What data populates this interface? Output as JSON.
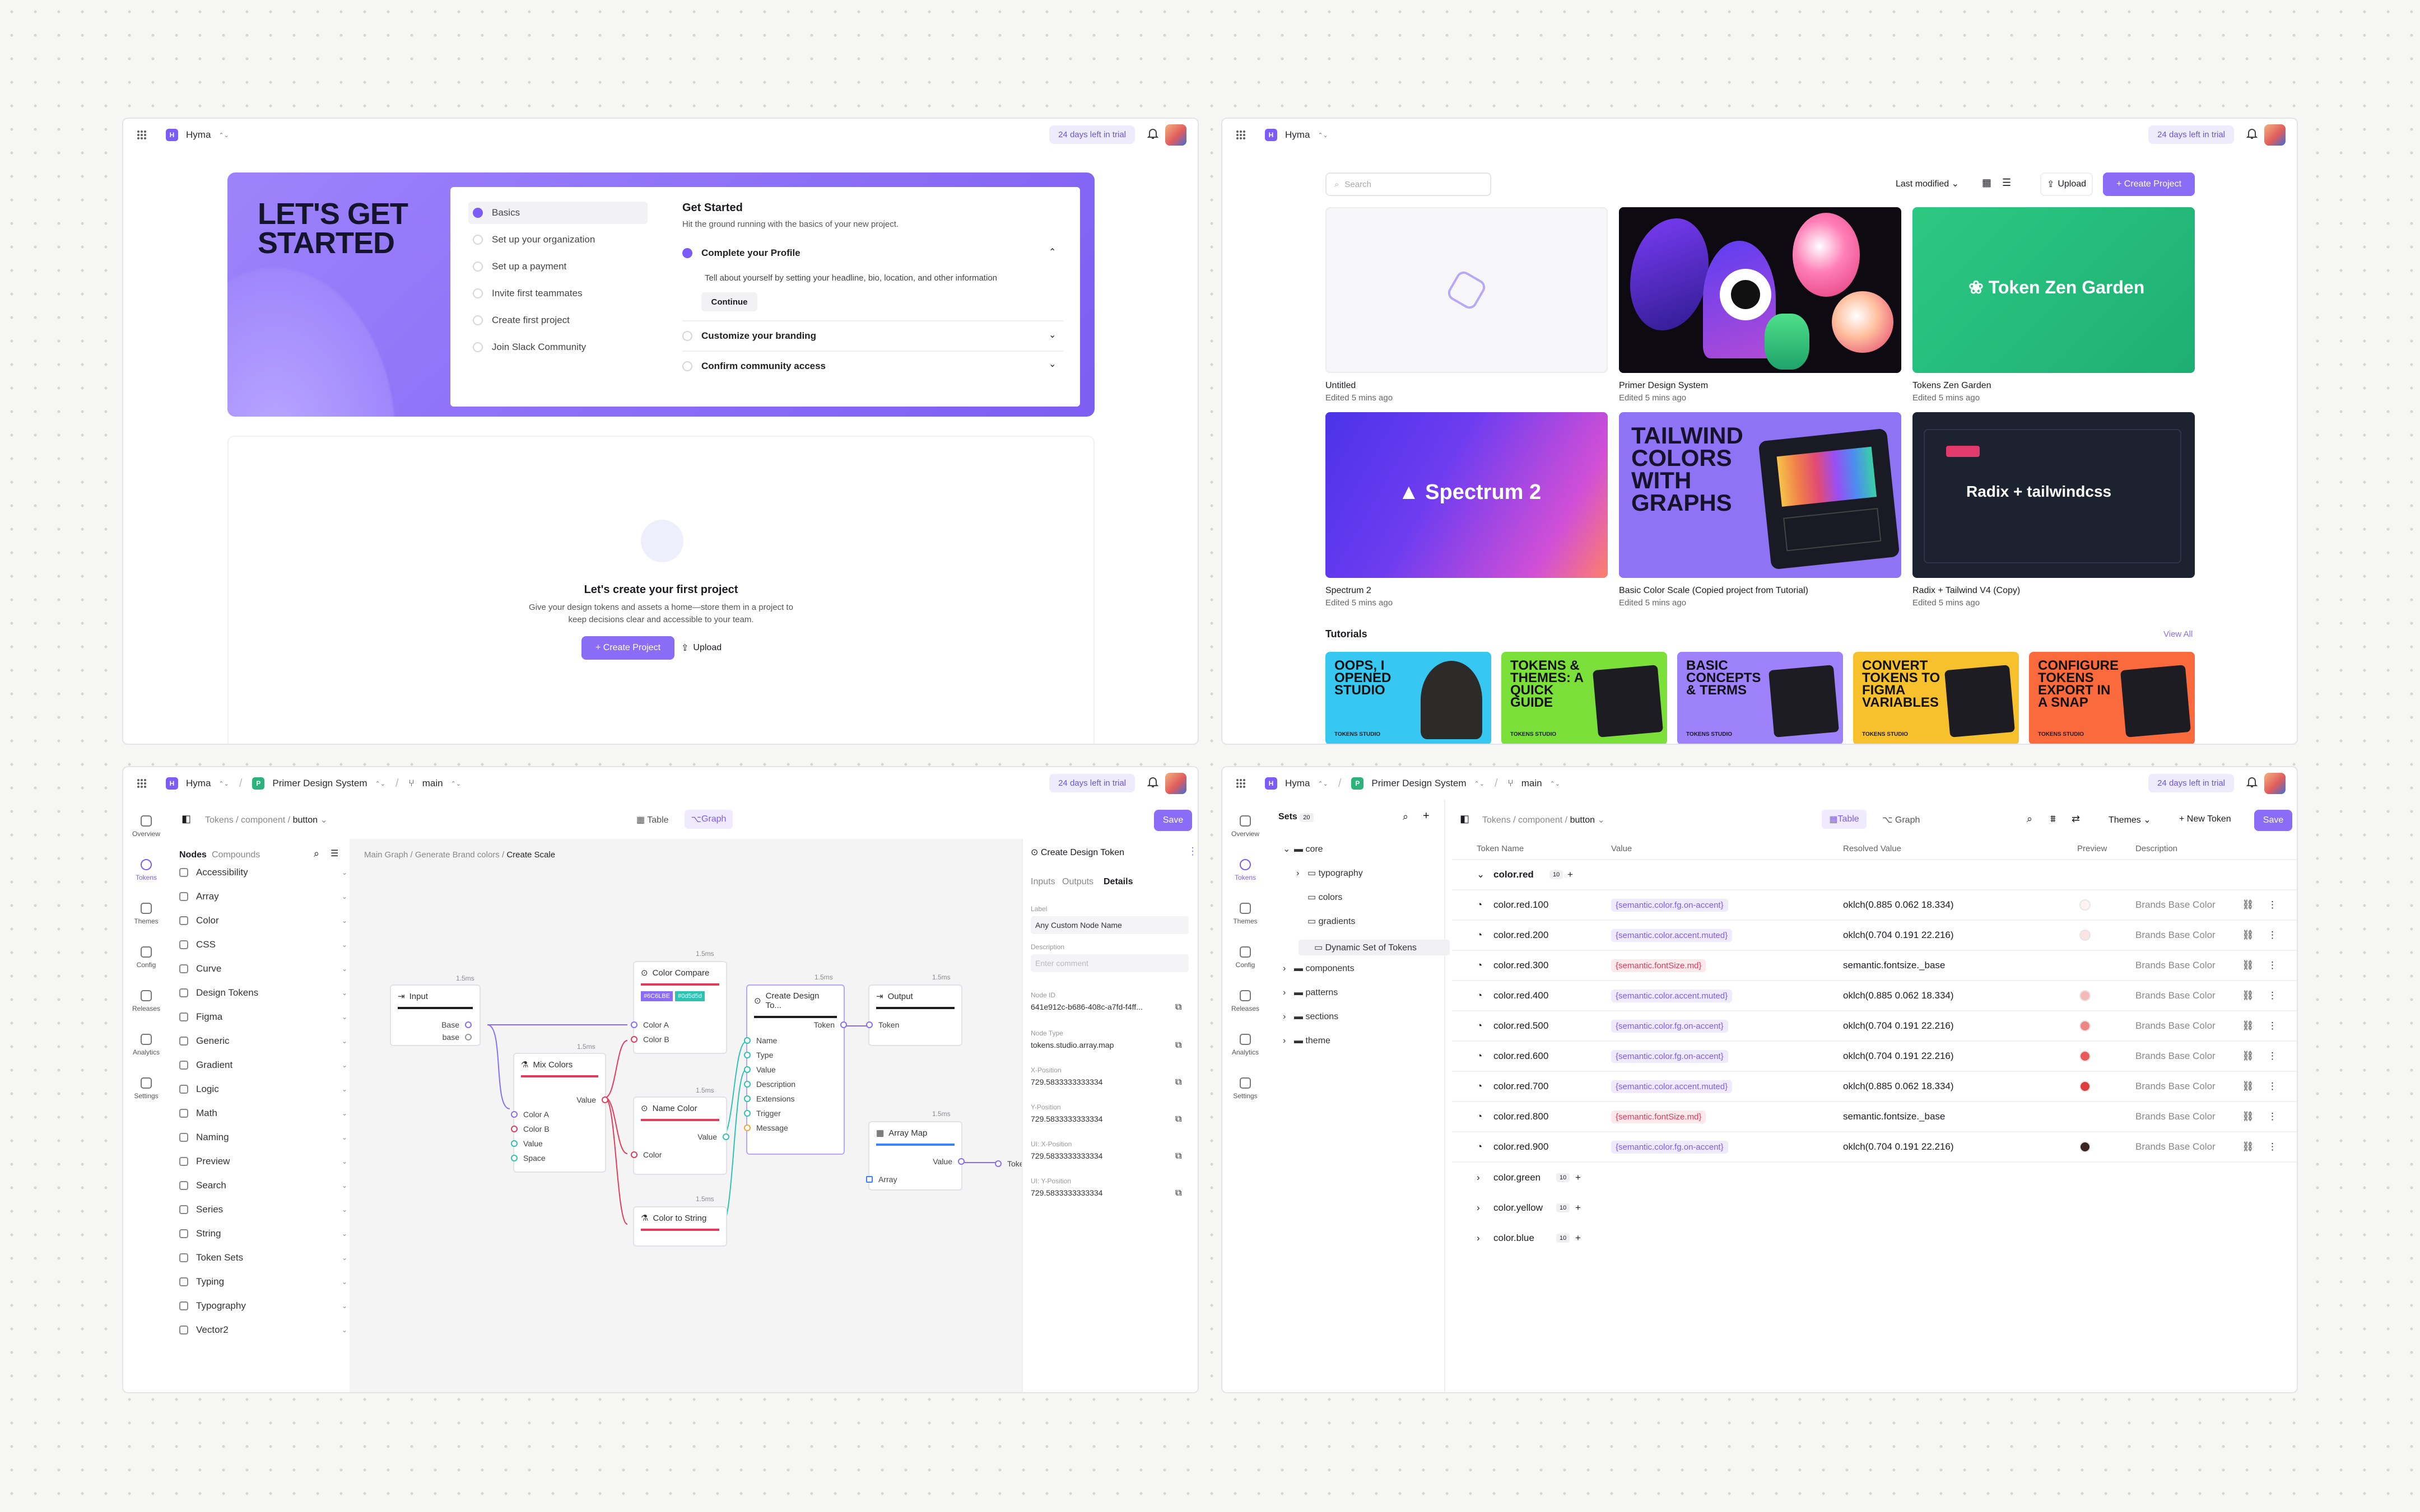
{
  "workspace": "Hyma",
  "trial": "24 days left in trial",
  "onboard": {
    "title_l1": "LET'S GET",
    "title_l2": "STARTED",
    "steps": [
      "Basics",
      "Set up your organization",
      "Set up a payment",
      "Invite first teammates",
      "Create first project",
      "Join Slack Community"
    ],
    "heading": "Get Started",
    "sub": "Hit the ground running with the basics of your new project.",
    "acc1": "Complete your Profile",
    "acc1_desc": "Tell about yourself by setting your headline, bio, location, and other information",
    "continue": "Continue",
    "acc2": "Customize your branding",
    "acc3": "Confirm community access",
    "empty_title": "Let's create your first project",
    "empty_desc1": "Give your design tokens and assets a home—store them in a project to",
    "empty_desc2": "keep decisions clear and accessible to your team.",
    "create_btn": "+ Create Project",
    "upload_btn": "Upload"
  },
  "projects": {
    "search_ph": "Search",
    "sort": "Last modified",
    "upload": "Upload",
    "create": "+ Create Project",
    "items": [
      {
        "name": "Untitled",
        "time": "Edited 5 mins ago"
      },
      {
        "name": "Primer Design System",
        "time": "Edited 5 mins ago"
      },
      {
        "name": "Tokens Zen Garden",
        "time": "Edited 5 mins ago",
        "label": "Token Zen Garden"
      },
      {
        "name": "Spectrum 2",
        "time": "Edited 5 mins ago",
        "label": "Spectrum 2"
      },
      {
        "name": "Basic Color Scale (Copied project from Tutorial)",
        "time": "Edited 5 mins ago",
        "label": "TAILWIND COLORS WITH GRAPHS"
      },
      {
        "name": "Radix + Tailwind V4 (Copy)",
        "time": "Edited 5 mins ago",
        "label": "Radix + tailwindcss"
      }
    ],
    "tutorials": "Tutorials",
    "view_all": "View All",
    "tut": [
      "OOPS, I OPENED STUDIO",
      "TOKENS & THEMES: A QUICK GUIDE",
      "BASIC CONCEPTS & TERMS",
      "CONVERT TOKENS TO FIGMA VARIABLES",
      "CONFIGURE TOKENS EXPORT IN A SNAP"
    ],
    "tut_brand": "TOKENS STUDIO"
  },
  "graph": {
    "project": "Primer Design System",
    "branch": "main",
    "nav": [
      "Overview",
      "Tokens",
      "Themes",
      "Config",
      "Releases",
      "Analytics",
      "Settings"
    ],
    "crumb1": "Tokens",
    "crumb2": "component",
    "crumb3": "button",
    "view_table": "Table",
    "view_graph": "Graph",
    "save": "Save",
    "tab_nodes": "Nodes",
    "tab_compounds": "Compounds",
    "nodes": [
      "Accessibility",
      "Array",
      "Color",
      "CSS",
      "Curve",
      "Design Tokens",
      "Figma",
      "Generic",
      "Gradient",
      "Logic",
      "Math",
      "Naming",
      "Preview",
      "Search",
      "Series",
      "String",
      "Token Sets",
      "Typing",
      "Typography",
      "Vector2"
    ],
    "path1": "Main Graph",
    "path2": "Generate Brand colors",
    "path3": "Create Scale",
    "n_input": "Input",
    "n_compare": "Color Compare",
    "n_mix": "Mix Colors",
    "n_name": "Name Color",
    "n_tostr": "Color to String",
    "n_create": "Create Design To...",
    "n_output": "Output",
    "n_arraymap": "Array Map",
    "p_base": "Base",
    "p_base2": "base",
    "p_colora": "Color A",
    "p_colorb": "Color B",
    "p_value": "Value",
    "p_space": "Space",
    "p_color": "Color",
    "p_name": "Name",
    "p_type": "Type",
    "p_desc": "Description",
    "p_ext": "Extensions",
    "p_trig": "Trigger",
    "p_msg": "Message",
    "p_token": "Token",
    "p_array": "Array",
    "p_toke": "Toke",
    "hex1": "#6C6LBE",
    "hex2": "#0d5d5d",
    "t15": "1.5ms",
    "panel_title": "Create Design Token",
    "ptabs": [
      "Inputs",
      "Outputs",
      "Details"
    ],
    "f_label": "Label",
    "v_label": "Any Custom Node Name",
    "f_desc": "Description",
    "v_desc": "Enter comment",
    "f_id": "Node ID",
    "v_id": "641e912c-b686-408c-a7fd-f4ff...",
    "f_type": "Node Type",
    "v_type": "tokens.studio.array.map",
    "f_x": "X-Position",
    "v_x": "729.5833333333334",
    "f_y": "Y-Position",
    "v_y": "729.5833333333334",
    "f_ux": "UI: X-Position",
    "v_ux": "729.5833333333334",
    "f_uy": "UI: Y-Position",
    "v_uy": "729.5833333333334"
  },
  "table": {
    "sets_label": "Sets",
    "sets_count": "20",
    "tree": [
      "core",
      "typography",
      "colors",
      "gradients",
      "Dynamic Set of Tokens",
      "components",
      "patterns",
      "sections",
      "theme"
    ],
    "themes": "Themes",
    "new_token": "+ New Token",
    "cols": [
      "Token Name",
      "Value",
      "Resolved Value",
      "Preview",
      "Description"
    ],
    "group": "color.red",
    "group_count": "10",
    "rows": [
      {
        "name": "color.red.100",
        "value": "{semantic.color.fg.on-accent}",
        "res": "oklch(0.885 0.062 18.334)",
        "sw": "#fdf3f3",
        "desc": "Brands Base Color"
      },
      {
        "name": "color.red.200",
        "value": "{semantic.color.accent.muted}",
        "res": "oklch(0.704 0.191 22.216)",
        "sw": "#fbe3e3",
        "desc": "Brands Base Color"
      },
      {
        "name": "color.red.300",
        "value": "{semantic.fontSize.md}",
        "res": "semantic.fontsize._base",
        "sw": "",
        "desc": "Brands Base Color"
      },
      {
        "name": "color.red.400",
        "value": "{semantic.color.accent.muted}",
        "res": "oklch(0.885 0.062 18.334)",
        "sw": "#f6b9b9",
        "desc": "Brands Base Color"
      },
      {
        "name": "color.red.500",
        "value": "{semantic.color.fg.on-accent}",
        "res": "oklch(0.704 0.191 22.216)",
        "sw": "#ef8585",
        "desc": "Brands Base Color"
      },
      {
        "name": "color.red.600",
        "value": "{semantic.color.fg.on-accent}",
        "res": "oklch(0.704 0.191 22.216)",
        "sw": "#e85a5a",
        "desc": "Brands Base Color"
      },
      {
        "name": "color.red.700",
        "value": "{semantic.color.accent.muted}",
        "res": "oklch(0.885 0.062 18.334)",
        "sw": "#dc3d3d",
        "desc": "Brands Base Color"
      },
      {
        "name": "color.red.800",
        "value": "{semantic.fontSize.md}",
        "res": "semantic.fontsize._base",
        "sw": "",
        "desc": "Brands Base Color"
      },
      {
        "name": "color.red.900",
        "value": "{semantic.color.fg.on-accent}",
        "res": "oklch(0.704 0.191 22.216)",
        "sw": "#3a2424",
        "desc": "Brands Base Color"
      }
    ],
    "groups": [
      {
        "name": "color.green",
        "count": "10"
      },
      {
        "name": "color.yellow",
        "count": "10"
      },
      {
        "name": "color.blue",
        "count": "10"
      }
    ]
  }
}
